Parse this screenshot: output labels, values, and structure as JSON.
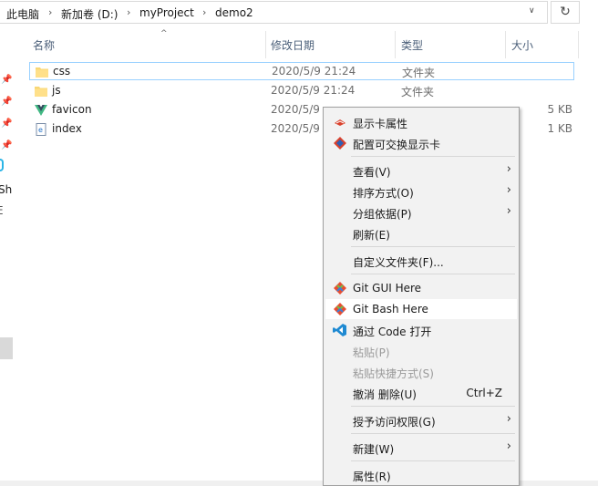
{
  "address": {
    "crumbs": [
      "此电脑",
      "新加卷 (D:)",
      "myProject",
      "demo2"
    ],
    "refresh_icon": "refresh-icon"
  },
  "columns": {
    "name": "名称",
    "modified": "修改日期",
    "type": "类型",
    "size": "大小"
  },
  "files": [
    {
      "name": "css",
      "modified": "2020/5/9 21:24",
      "type": "文件夹",
      "size": "",
      "icon": "folder-icon"
    },
    {
      "name": "js",
      "modified": "2020/5/9 21:24",
      "type": "文件夹",
      "size": "",
      "icon": "folder-icon"
    },
    {
      "name": "favicon",
      "modified": "2020/5/9",
      "type": "",
      "size": "5 KB",
      "icon": "vue-icon"
    },
    {
      "name": "index",
      "modified": "2020/5/9",
      "type": "",
      "size": "1 KB",
      "icon": "html-file-icon"
    }
  ],
  "leftpane": {
    "fragment1": "Sh",
    "fragment2": "E"
  },
  "menu": {
    "items": [
      {
        "label": "显示卡属性",
        "icon": "display-card-icon"
      },
      {
        "label": "配置可交换显示卡",
        "icon": "switchable-graphics-icon"
      },
      {
        "label": "查看(V)",
        "submenu": true
      },
      {
        "label": "排序方式(O)",
        "submenu": true
      },
      {
        "label": "分组依据(P)",
        "submenu": true
      },
      {
        "label": "刷新(E)"
      },
      {
        "label": "自定义文件夹(F)..."
      },
      {
        "label": "Git GUI Here",
        "icon": "git-icon"
      },
      {
        "label": "Git Bash Here",
        "icon": "git-icon"
      },
      {
        "label": "通过 Code 打开",
        "icon": "vscode-icon"
      },
      {
        "label": "粘贴(P)",
        "disabled": true
      },
      {
        "label": "粘贴快捷方式(S)",
        "disabled": true
      },
      {
        "label": "撤消 删除(U)",
        "shortcut": "Ctrl+Z"
      },
      {
        "label": "授予访问权限(G)",
        "submenu": true
      },
      {
        "label": "新建(W)",
        "submenu": true
      },
      {
        "label": "属性(R)"
      }
    ]
  },
  "colors": {
    "selection_border": "#99d1ff",
    "menu_bg": "#f2f2f2",
    "folder": "#f8d775",
    "header_text": "#4c607a"
  }
}
